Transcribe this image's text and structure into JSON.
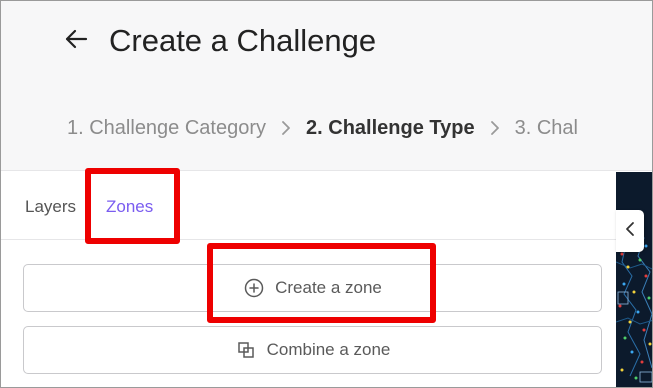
{
  "header": {
    "title": "Create a Challenge",
    "steps": [
      {
        "label": "1. Challenge Category",
        "active": false
      },
      {
        "label": "2. Challenge Type",
        "active": true
      },
      {
        "label": "3. Chal",
        "active": false
      }
    ]
  },
  "sidebar": {
    "tabs": [
      {
        "label": "Layers",
        "selected": false
      },
      {
        "label": "Zones",
        "selected": true
      }
    ],
    "buttons": {
      "create_zone": "Create a zone",
      "combine_zone": "Combine a zone"
    }
  },
  "icons": {
    "back": "arrow-left-icon",
    "step_separator": "chevron-right-icon",
    "create_zone": "plus-circle-icon",
    "combine_zone": "combine-squares-icon",
    "map_toggle": "chevron-left-icon"
  },
  "colors": {
    "accent": "#7a5cf0",
    "highlight": "#ee0000",
    "map_background": "#0c1a2c"
  }
}
